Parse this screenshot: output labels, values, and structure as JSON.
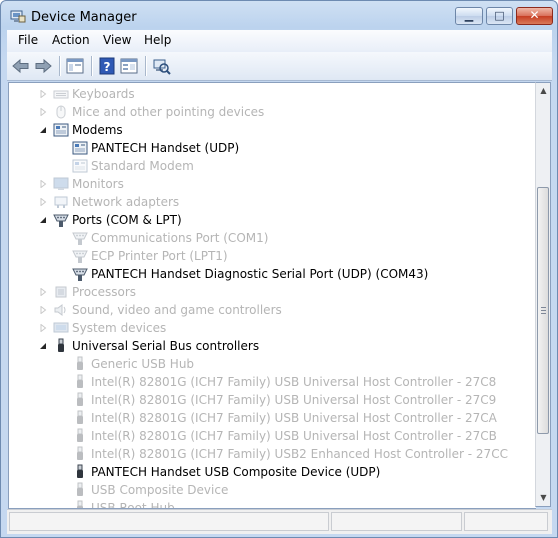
{
  "window": {
    "title": "Device Manager",
    "min_glyph": "▁",
    "max_glyph": "□",
    "close_glyph": "✕"
  },
  "menu": [
    "File",
    "Action",
    "View",
    "Help"
  ],
  "toolbar": {
    "back_icon": "back-arrow-icon",
    "forward_icon": "forward-arrow-icon",
    "show_hide_tree_icon": "console-tree-icon",
    "help_icon": "help-icon",
    "properties_icon": "properties-icon",
    "scan_icon": "scan-hardware-icon",
    "help_glyph": "?"
  },
  "tree": [
    {
      "label": "Keyboards",
      "level": 1,
      "state": "collapsed",
      "dim": true,
      "icon": "keyboard-icon"
    },
    {
      "label": "Mice and other pointing devices",
      "level": 1,
      "state": "collapsed",
      "dim": true,
      "icon": "mouse-icon"
    },
    {
      "label": "Modems",
      "level": 1,
      "state": "expanded",
      "dim": false,
      "icon": "modem-icon"
    },
    {
      "label": "PANTECH Handset (UDP)",
      "level": 2,
      "state": "leaf",
      "dim": false,
      "icon": "modem-icon"
    },
    {
      "label": "Standard Modem",
      "level": 2,
      "state": "leaf",
      "dim": true,
      "icon": "modem-icon"
    },
    {
      "label": "Monitors",
      "level": 1,
      "state": "collapsed",
      "dim": true,
      "icon": "monitor-icon"
    },
    {
      "label": "Network adapters",
      "level": 1,
      "state": "collapsed",
      "dim": true,
      "icon": "network-icon"
    },
    {
      "label": "Ports (COM & LPT)",
      "level": 1,
      "state": "expanded",
      "dim": false,
      "icon": "port-icon"
    },
    {
      "label": "Communications Port (COM1)",
      "level": 2,
      "state": "leaf",
      "dim": true,
      "icon": "port-icon"
    },
    {
      "label": "ECP Printer Port (LPT1)",
      "level": 2,
      "state": "leaf",
      "dim": true,
      "icon": "port-icon"
    },
    {
      "label": "PANTECH Handset Diagnostic Serial Port (UDP)  (COM43)",
      "level": 2,
      "state": "leaf",
      "dim": false,
      "icon": "port-icon"
    },
    {
      "label": "Processors",
      "level": 1,
      "state": "collapsed",
      "dim": true,
      "icon": "processor-icon"
    },
    {
      "label": "Sound, video and game controllers",
      "level": 1,
      "state": "collapsed",
      "dim": true,
      "icon": "sound-icon"
    },
    {
      "label": "System devices",
      "level": 1,
      "state": "collapsed",
      "dim": true,
      "icon": "system-icon"
    },
    {
      "label": "Universal Serial Bus controllers",
      "level": 1,
      "state": "expanded",
      "dim": false,
      "icon": "usb-icon"
    },
    {
      "label": "Generic USB Hub",
      "level": 2,
      "state": "leaf",
      "dim": true,
      "icon": "usb-icon"
    },
    {
      "label": "Intel(R) 82801G (ICH7 Family) USB Universal Host Controller - 27C8",
      "level": 2,
      "state": "leaf",
      "dim": true,
      "icon": "usb-icon"
    },
    {
      "label": "Intel(R) 82801G (ICH7 Family) USB Universal Host Controller - 27C9",
      "level": 2,
      "state": "leaf",
      "dim": true,
      "icon": "usb-icon"
    },
    {
      "label": "Intel(R) 82801G (ICH7 Family) USB Universal Host Controller - 27CA",
      "level": 2,
      "state": "leaf",
      "dim": true,
      "icon": "usb-icon"
    },
    {
      "label": "Intel(R) 82801G (ICH7 Family) USB Universal Host Controller - 27CB",
      "level": 2,
      "state": "leaf",
      "dim": true,
      "icon": "usb-icon"
    },
    {
      "label": "Intel(R) 82801G (ICH7 Family) USB2 Enhanced Host Controller - 27CC",
      "level": 2,
      "state": "leaf",
      "dim": true,
      "icon": "usb-icon"
    },
    {
      "label": "PANTECH Handset USB Composite Device (UDP)",
      "level": 2,
      "state": "leaf",
      "dim": false,
      "icon": "usb-icon"
    },
    {
      "label": "USB Composite Device",
      "level": 2,
      "state": "leaf",
      "dim": true,
      "icon": "usb-icon"
    },
    {
      "label": "USB Root Hub",
      "level": 2,
      "state": "leaf",
      "dim": true,
      "icon": "usb-icon"
    }
  ],
  "scrollbar": {
    "up_glyph": "▲",
    "down_glyph": "▼"
  },
  "colors": {
    "dim_text": "#b5b5b5",
    "title_bar": "#bcd3ee",
    "close_button": "#c63d23"
  }
}
